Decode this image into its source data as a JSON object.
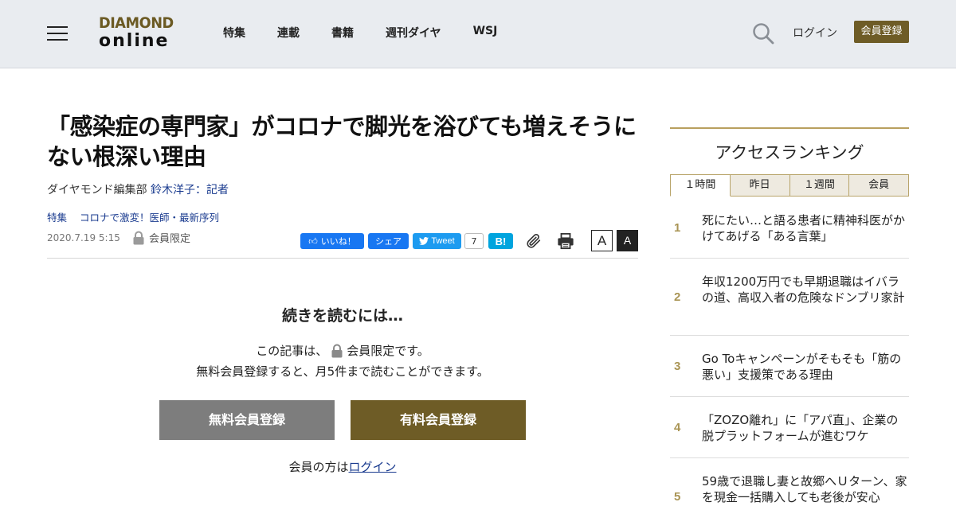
{
  "header": {
    "logo_top": "DIAMOND",
    "logo_bottom": "online",
    "nav": [
      "特集",
      "連載",
      "書籍",
      "週刊ダイヤ",
      "WSJ"
    ],
    "login": "ログイン",
    "register": "会員登録"
  },
  "article": {
    "title": "「感染症の専門家」がコロナで脚光を浴びても増えそうにない根深い理由",
    "byline_prefix": "ダイヤモンド編集部 ",
    "author": "鈴木洋子：記者",
    "tags": [
      "特集",
      "コロナで激変！医師・最新序列"
    ],
    "date": "2020.7.19 5:15",
    "members_only": "会員限定",
    "share": {
      "like": "いいね！",
      "share": "シェア",
      "tweet": "Tweet",
      "tweet_count": "7",
      "hatena": "B!"
    },
    "font_small": "A",
    "font_large": "A"
  },
  "paywall": {
    "title": "続きを読むには…",
    "line1_prefix": "この記事は、",
    "line1_suffix": "会員限定です。",
    "line2": "無料会員登録すると、月5件まで読むことができます。",
    "free_button": "無料会員登録",
    "paid_button": "有料会員登録",
    "login_prefix": "会員の方は",
    "login_link": "ログイン"
  },
  "ranking": {
    "title": "アクセスランキング",
    "tabs": [
      "１時間",
      "昨日",
      "１週間",
      "会員"
    ],
    "items": [
      {
        "rank": "1",
        "text": "死にたい…と語る患者に精神科医がかけてあげる「ある言葉」"
      },
      {
        "rank": "2",
        "text": "年収1200万円でも早期退職はイバラの道、高収入者の危険なドンブリ家計"
      },
      {
        "rank": "3",
        "text": "Go Toキャンペーンがそもそも「筋の悪い」支援策である理由"
      },
      {
        "rank": "4",
        "text": "「ZOZO離れ」に「アパ直」、企業の脱プラットフォームが進むワケ"
      },
      {
        "rank": "5",
        "text": "59歳で退職し妻と故郷へＵターン、家を現金一括購入しても老後が安心"
      }
    ]
  },
  "colors": {
    "brand_gold": "#6e5c26",
    "header_bg": "#e9ecf0",
    "link_blue": "#1a3b8f",
    "rank_gold": "#a99454"
  }
}
